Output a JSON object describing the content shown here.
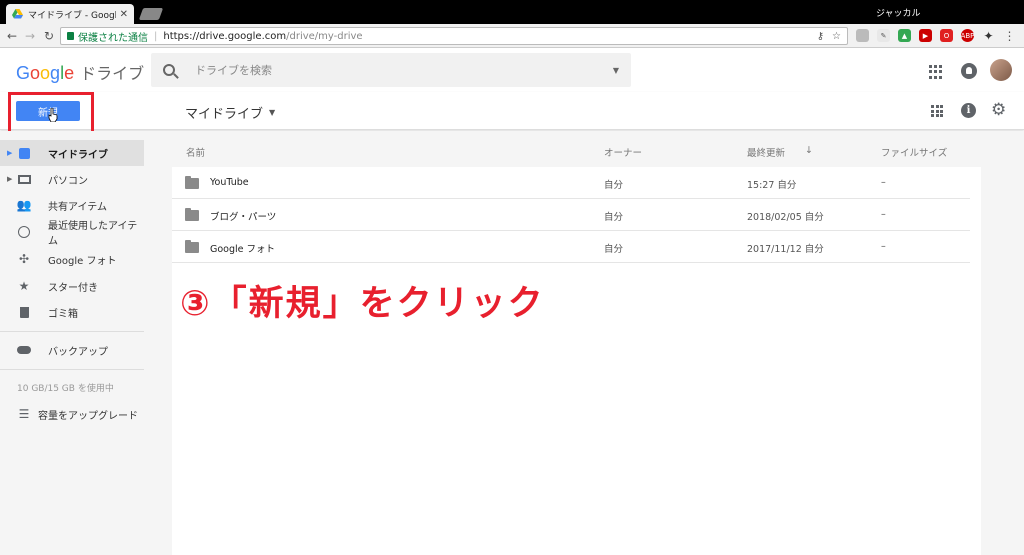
{
  "browser": {
    "tab_title": "マイドライブ - Google ドライブ",
    "profile_name": "ジャッカル",
    "secure_label": "保護された通信",
    "url_host": "https://drive.google.com",
    "url_path": "/drive/my-drive"
  },
  "header": {
    "logo_g": [
      "G",
      "o",
      "o",
      "g",
      "l",
      "e"
    ],
    "app_name": "ドライブ",
    "search_placeholder": "ドライブを検索"
  },
  "toolbar": {
    "new_button": "新規",
    "breadcrumb": "マイドライブ"
  },
  "sidebar": {
    "items": [
      {
        "label": "マイドライブ",
        "icon": "drive-icon"
      },
      {
        "label": "パソコン",
        "icon": "computer-icon"
      },
      {
        "label": "共有アイテム",
        "icon": "people-icon"
      },
      {
        "label": "最近使用したアイテム",
        "icon": "clock-icon"
      },
      {
        "label": "Google フォト",
        "icon": "pinwheel-icon"
      },
      {
        "label": "スター付き",
        "icon": "star-icon"
      },
      {
        "label": "ゴミ箱",
        "icon": "trash-icon"
      },
      {
        "label": "バックアップ",
        "icon": "cloud-icon"
      }
    ],
    "storage": "10 GB/15 GB を使用中",
    "upgrade": "容量をアップグレード"
  },
  "files": {
    "columns": {
      "name": "名前",
      "owner": "オーナー",
      "modified": "最終更新",
      "size": "ファイルサイズ"
    },
    "rows": [
      {
        "name": "YouTube",
        "owner": "自分",
        "modified": "15:27 自分",
        "size": "–"
      },
      {
        "name": "ブログ・パーツ",
        "owner": "自分",
        "modified": "2018/02/05 自分",
        "size": "–"
      },
      {
        "name": "Google フォト",
        "owner": "自分",
        "modified": "2017/11/12 自分",
        "size": "–"
      }
    ]
  },
  "annotation": "③「新規」をクリック",
  "colors": {
    "accent": "#4285f4",
    "annotation": "#e8202e"
  }
}
